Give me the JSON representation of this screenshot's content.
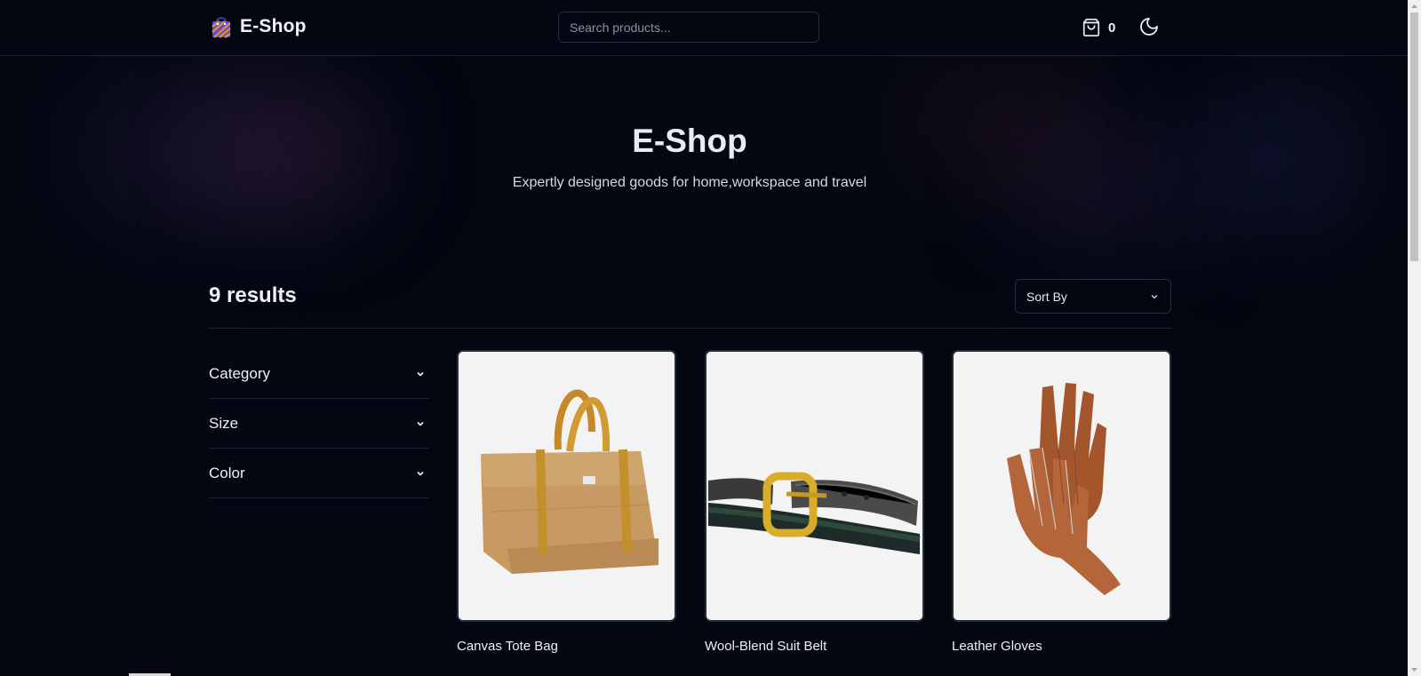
{
  "header": {
    "logo_text": "E-Shop",
    "search_placeholder": "Search products...",
    "cart_count": "0"
  },
  "hero": {
    "title": "E-Shop",
    "subtitle": "Expertly designed goods for home,workspace and travel"
  },
  "results": {
    "count_label": "9 results",
    "sort_label": "Sort By"
  },
  "filters": [
    {
      "label": "Category"
    },
    {
      "label": "Size"
    },
    {
      "label": "Color"
    }
  ],
  "products": [
    {
      "name": "Canvas Tote Bag",
      "icon": "tote-bag-image"
    },
    {
      "name": "Wool-Blend Suit Belt",
      "icon": "belt-image"
    },
    {
      "name": "Leather Gloves",
      "icon": "gloves-image"
    }
  ],
  "colors": {
    "background": "#030711",
    "border": "#1e2433",
    "text": "#eef0f4",
    "muted": "#8b92a3"
  }
}
